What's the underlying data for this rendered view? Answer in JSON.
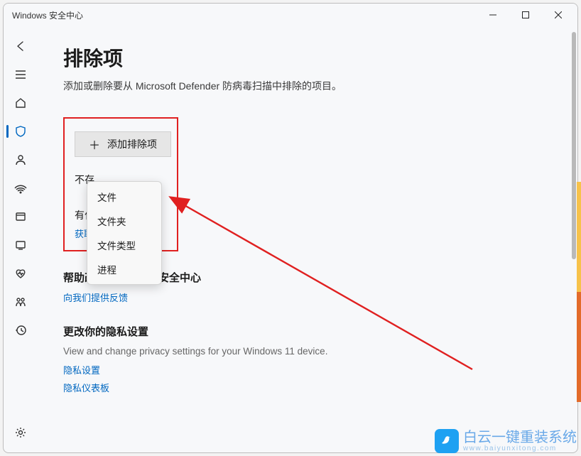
{
  "window": {
    "title": "Windows 安全中心"
  },
  "page": {
    "heading": "排除项",
    "description": "添加或删除要从 Microsoft Defender 防病毒扫描中排除的项目。"
  },
  "add_button": {
    "label": "添加排除项"
  },
  "dropdown": {
    "items": [
      "文件",
      "文件夹",
      "文件类型",
      "进程"
    ]
  },
  "partial": {
    "line1": "不存",
    "line2": "有什",
    "link": "获取"
  },
  "help_section": {
    "heading": "帮助改进 Windows 安全中心",
    "link": "向我们提供反馈"
  },
  "privacy_section": {
    "heading": "更改你的隐私设置",
    "body": "View and change privacy settings for your Windows 11 device.",
    "link1": "隐私设置",
    "link2": "隐私仪表板"
  },
  "watermark": {
    "main": "白云一键重装系统",
    "sub": "www.baiyunxitong.com"
  }
}
